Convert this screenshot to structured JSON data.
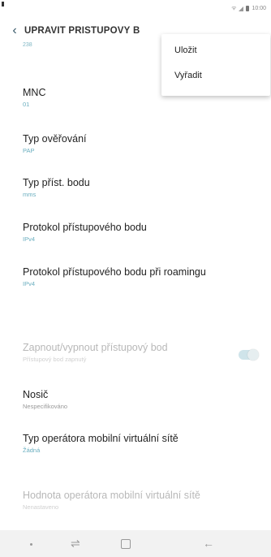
{
  "status": {
    "time": "10:00",
    "icons": [
      "wifi-icon",
      "signal-icon",
      "battery-icon"
    ]
  },
  "header": {
    "title": "UPRAVIT PŘÍSTUPOVÝ B"
  },
  "menu": {
    "items": [
      "Uložit",
      "Vyřadit"
    ]
  },
  "list": {
    "cut_sub": "238",
    "items": [
      {
        "label": "MNC",
        "value": "01"
      },
      {
        "label": "Typ ověřování",
        "value": "PAP"
      },
      {
        "label": "Typ příst. bodu",
        "value": "mms"
      },
      {
        "label": "Protokol přístupového bodu",
        "value": "IPv4"
      },
      {
        "label": "Protokol přístupového bodu při roamingu",
        "value": "IPv4"
      },
      {
        "label": "Zapnout/vypnout přístupový bod",
        "value": "Přístupový bod zapnutý"
      },
      {
        "label": "Nosič",
        "value": "Nespecifikováno"
      },
      {
        "label": "Typ operátora mobilní virtuální sítě",
        "value": "Žádná"
      },
      {
        "label": "Hodnota operátora mobilní virtuální sítě",
        "value": "Nenastaveno"
      }
    ]
  },
  "nav": {
    "icons": [
      "dot-icon",
      "recent-apps-icon",
      "home-icon",
      "back-icon"
    ]
  },
  "colors": {
    "accent": "#6aaebf",
    "background": "#ffffff",
    "nav_bg": "#f2f2f2"
  }
}
